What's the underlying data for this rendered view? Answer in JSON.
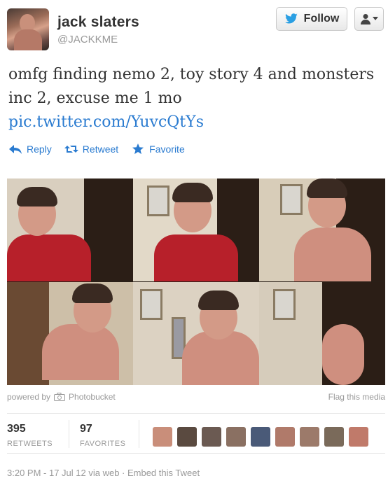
{
  "user": {
    "name": "jack slaters",
    "handle": "@JACKKME"
  },
  "header": {
    "follow_label": "Follow"
  },
  "tweet": {
    "text": "omfg finding nemo 2, toy story 4 and monsters inc 2, excuse me 1 mo",
    "link": "pic.twitter.com/YuvcQtYs"
  },
  "actions": {
    "reply": "Reply",
    "retweet": "Retweet",
    "favorite": "Favorite"
  },
  "media": {
    "powered_by": "powered by",
    "provider": "Photobucket",
    "flag": "Flag this media"
  },
  "stats": {
    "retweets_count": "395",
    "retweets_label": "RETWEETS",
    "favorites_count": "97",
    "favorites_label": "FAVORITES"
  },
  "faces": [
    "#c98e7a",
    "#5a4a40",
    "#6b5a52",
    "#8a7062",
    "#4a5a78",
    "#b07a6a",
    "#9c7a6a",
    "#7a6a5a",
    "#c07a6a"
  ],
  "meta": {
    "timestamp": "3:20 PM - 17 Jul 12 via web · Embed this Tweet"
  },
  "colors": {
    "link": "#2a7bd0",
    "follow_bird": "#2a9fe3"
  },
  "icons": [
    "twitter-bird-icon",
    "user-icon",
    "chevron-down-icon",
    "reply-icon",
    "retweet-icon",
    "star-icon",
    "camera-icon"
  ]
}
